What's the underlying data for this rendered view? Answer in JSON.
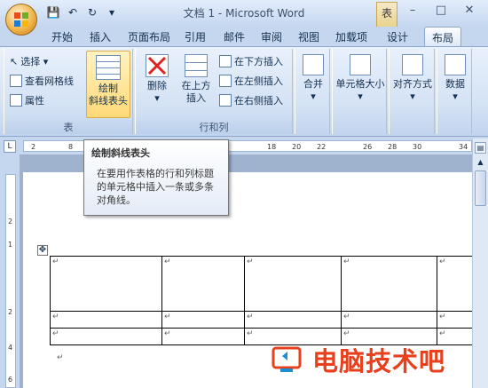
{
  "window": {
    "title": "文档 1 - Microsoft Word",
    "context_tab": "表",
    "minimize": "–",
    "maximize": "□",
    "close": "✕"
  },
  "qat": {
    "save": "💾",
    "undo": "↶",
    "redo": "↻",
    "more": "▾"
  },
  "tabs": [
    "开始",
    "插入",
    "页面布局",
    "引用",
    "邮件",
    "审阅",
    "视图",
    "加载项",
    "设计",
    "布局"
  ],
  "ribbon": {
    "table_group": {
      "label": "表",
      "select": "选择 ▾",
      "gridlines": "查看网格线",
      "properties": "属性",
      "draw_diag_line1": "绘制",
      "draw_diag_line2": "斜线表头"
    },
    "rows_cols_group": {
      "label": "行和列",
      "delete": "删除",
      "insert_above_line1": "在上方",
      "insert_above_line2": "插入",
      "insert_below": "在下方插入",
      "insert_left": "在左侧插入",
      "insert_right": "在右侧插入"
    },
    "merge": "合并",
    "cell_size": "单元格大小",
    "alignment": "对齐方式",
    "data": "数据"
  },
  "ruler_numbers": [
    "2",
    "8",
    "18",
    "20",
    "22",
    "26",
    "28",
    "30",
    "34"
  ],
  "vruler_numbers": [
    "2",
    "1",
    "2",
    "4",
    "6"
  ],
  "tooltip": {
    "title": "绘制斜线表头",
    "body": "在要用作表格的行和列标题的单元格中插入一条或多条对角线。"
  },
  "table": {
    "rows": 3,
    "cols": 5
  },
  "watermark": {
    "text": "电脑技术吧"
  },
  "colors": {
    "accent": "#e8401c",
    "ribbon": "#d2e1f4"
  }
}
